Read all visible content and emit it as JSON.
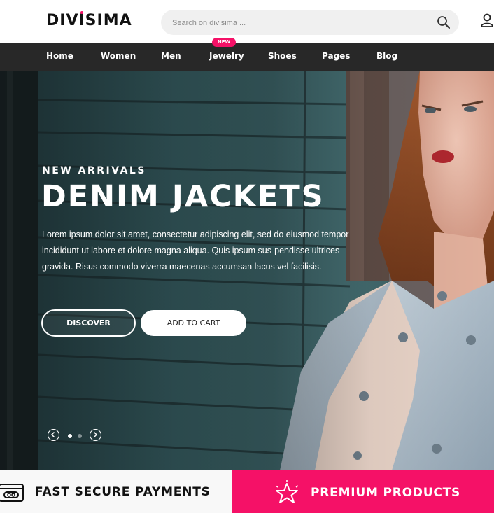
{
  "brand": {
    "logo_text": "DIVISIMA",
    "accent_color": "#f51167"
  },
  "search": {
    "placeholder": "Search on divisima ...",
    "icon": "search-icon"
  },
  "header": {
    "user_icon": "user-icon"
  },
  "nav": {
    "items": [
      {
        "label": "Home"
      },
      {
        "label": "Women"
      },
      {
        "label": "Men"
      },
      {
        "label": "Jewelry",
        "badge": "NEW"
      },
      {
        "label": "Shoes"
      },
      {
        "label": "Pages"
      },
      {
        "label": "Blog"
      }
    ]
  },
  "hero": {
    "eyebrow": "NEW ARRIVALS",
    "title": "DENIM JACKETS",
    "description": "Lorem ipsum dolor sit amet, consectetur adipiscing elit, sed do eiusmod tempor incididunt ut labore et dolore magna aliqua. Quis ipsum sus-pendisse ultrices gravida. Risus commodo viverra maecenas accumsan lacus vel facilisis.",
    "primary_button": "DISCOVER",
    "secondary_button": "ADD TO CART",
    "slider": {
      "prev_icon": "chevron-left-icon",
      "next_icon": "chevron-right-icon",
      "slides": 2,
      "active_slide": 1
    }
  },
  "features": [
    {
      "label": "FAST SECURE PAYMENTS",
      "icon": "wallet-icon"
    },
    {
      "label": "PREMIUM PRODUCTS",
      "icon": "star-icon"
    }
  ]
}
